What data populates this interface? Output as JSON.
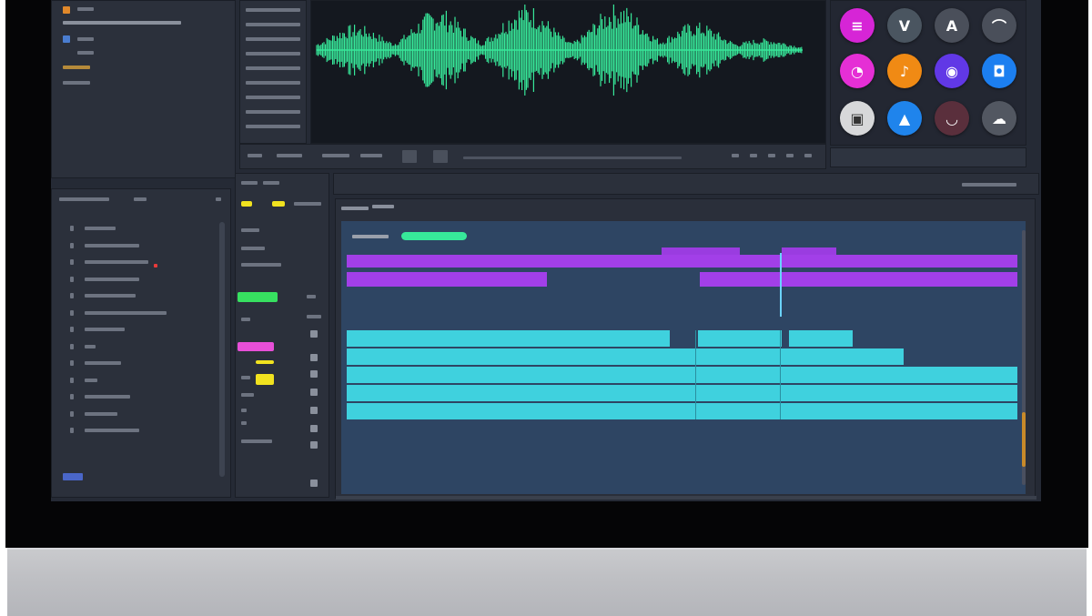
{
  "colors": {
    "waveform": "#37e89a",
    "purple_clip": "#a23fe8",
    "cyan_clip": "#3fd1de",
    "track_bg": "#2e4563",
    "green_swatch": "#37e060",
    "magenta_swatch": "#e84fd8",
    "yellow_swatch": "#f1e21f"
  },
  "icons": [
    {
      "name": "messenger-icon",
      "glyph": "≡",
      "color": "#d625d6"
    },
    {
      "name": "vine-icon",
      "glyph": "V",
      "color": "#4a5560"
    },
    {
      "name": "a-app-icon",
      "glyph": "A",
      "color": "#4a4f5a"
    },
    {
      "name": "arc-app-icon",
      "glyph": "⌒",
      "color": "#4a4f5a"
    },
    {
      "name": "pink-app-icon",
      "glyph": "◔",
      "color": "#e52fd5"
    },
    {
      "name": "orange-app-icon",
      "glyph": "♪",
      "color": "#f08a14"
    },
    {
      "name": "purple-app-icon",
      "glyph": "◉",
      "color": "#6138e6"
    },
    {
      "name": "blue-app-icon",
      "glyph": "◘",
      "color": "#1c7ff0"
    },
    {
      "name": "gray-app-icon",
      "glyph": "▣",
      "color": "#d7d8da"
    },
    {
      "name": "cloud-app-icon",
      "glyph": "▲",
      "color": "#1f84ec"
    },
    {
      "name": "red-app-icon",
      "glyph": "◡",
      "color": "#5a2f3c"
    },
    {
      "name": "cloud-gray-icon",
      "glyph": "☁",
      "color": "#525761"
    }
  ],
  "timeline": {
    "purple_track": {
      "clips": [
        [
          0,
          0.3
        ],
        [
          0.52,
          1.0
        ]
      ]
    },
    "cyan_tracks_count": 5
  }
}
